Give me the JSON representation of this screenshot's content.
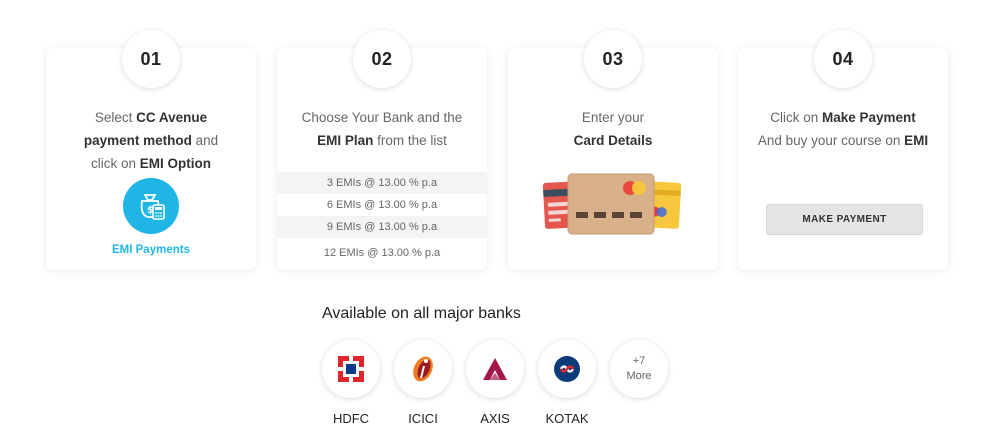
{
  "steps": [
    {
      "number": "01",
      "line1": {
        "pre": "Select ",
        "bold": "CC Avenue"
      },
      "line2": {
        "bold": "payment method",
        "post": " and"
      },
      "line3": {
        "pre": "click on ",
        "bold": "EMI Option"
      },
      "icon": "money-bag-calculator-icon",
      "link_label": "EMI Payments"
    },
    {
      "number": "02",
      "line1": {
        "text": "Choose Your Bank and the"
      },
      "line2": {
        "bold": "EMI Plan",
        "post": " from the list"
      },
      "plans": [
        "3 EMIs @ 13.00 % p.a",
        "6 EMIs @ 13.00 % p.a",
        "9 EMIs @ 13.00 % p.a",
        "12 EMIs @ 13.00 % p.a"
      ]
    },
    {
      "number": "03",
      "line1": {
        "text": "Enter your"
      },
      "line2": {
        "bold": "Card Details"
      },
      "icon": "credit-cards-illustration"
    },
    {
      "number": "04",
      "line1": {
        "pre": "Click on ",
        "bold": "Make Payment"
      },
      "line2": {
        "pre": "And buy your course on ",
        "bold": "EMI"
      },
      "button_label": "MAKE PAYMENT"
    }
  ],
  "banks_section": {
    "title": "Available on all major banks",
    "banks": [
      {
        "name": "HDFC",
        "icon": "hdfc-logo"
      },
      {
        "name": "ICICI",
        "icon": "icici-logo"
      },
      {
        "name": "AXIS",
        "icon": "axis-logo"
      },
      {
        "name": "KOTAK",
        "icon": "kotak-logo"
      }
    ],
    "more": {
      "count": "+7",
      "label": "More"
    }
  },
  "colors": {
    "accent": "#1fb6e6",
    "button_bg": "#e4e4e4",
    "hdfc_red": "#e0262c",
    "hdfc_blue": "#0b3a8b",
    "icici_orange": "#f07d1e",
    "icici_maroon": "#9b1c20",
    "axis_maroon": "#a3174b",
    "kotak_blue": "#0a3c7a",
    "kotak_red": "#e3242b"
  }
}
